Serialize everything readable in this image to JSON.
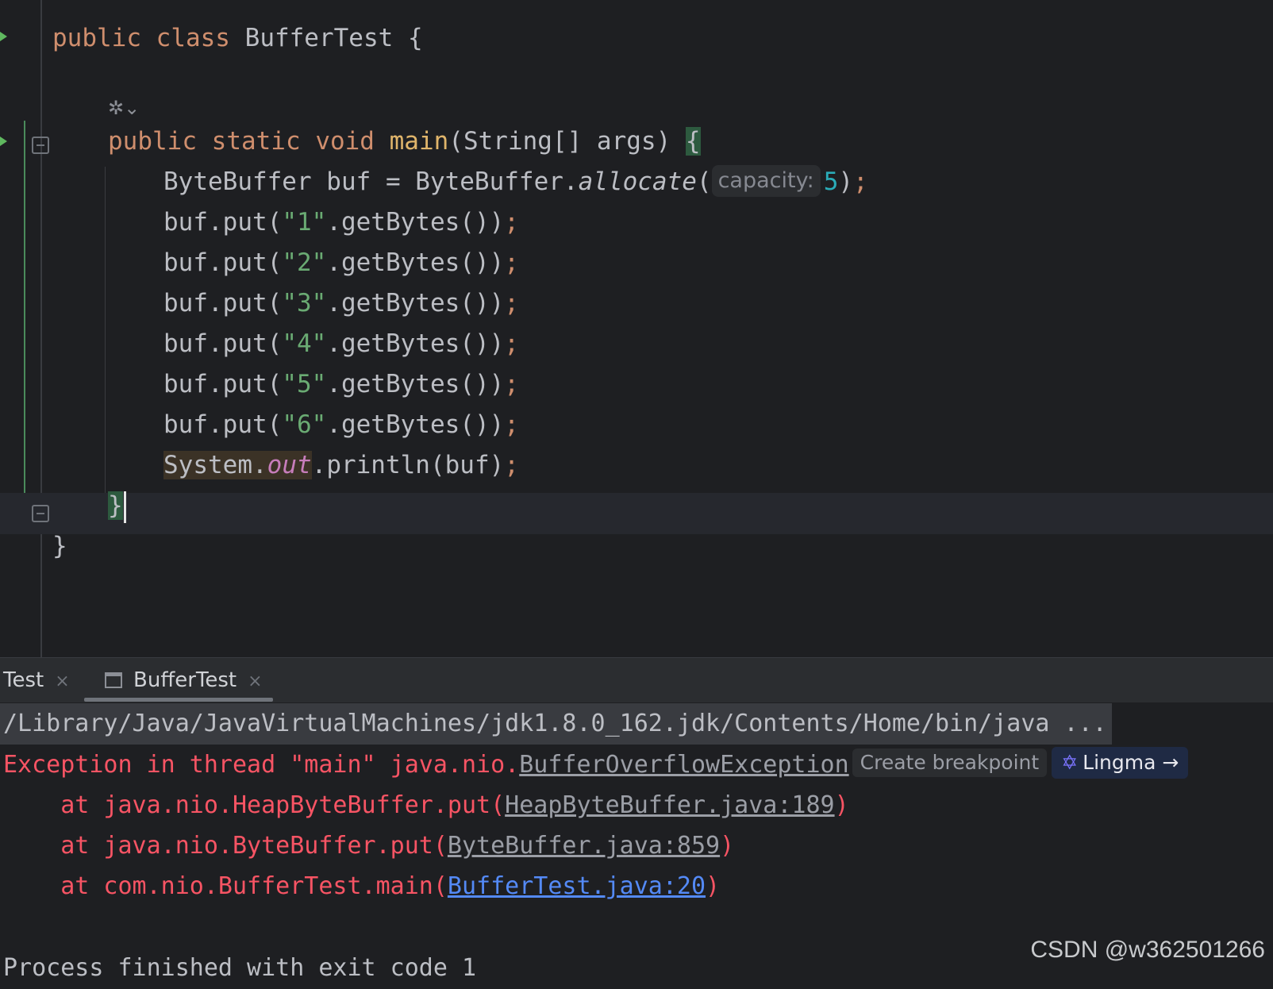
{
  "editor": {
    "class_kw1": "public",
    "class_kw2": "class",
    "class_name": "BufferTest",
    "open_brace": "{",
    "ai_icon": "✲⌄",
    "main_kw1": "public",
    "main_kw2": "static",
    "main_kw3": "void",
    "main_name": "main",
    "main_params": "(String[] args) ",
    "main_brace": "{",
    "alloc_prefix": "ByteBuffer buf = ByteBuffer.",
    "alloc_fn": "allocate",
    "alloc_open": "(",
    "alloc_hint": "capacity:",
    "alloc_num": "5",
    "alloc_close": ")",
    "semi": ";",
    "put_prefix": "buf.put(",
    "put_suffix": ".getBytes())",
    "put_strings": [
      "\"1\"",
      "\"2\"",
      "\"3\"",
      "\"4\"",
      "\"5\"",
      "\"6\""
    ],
    "println_sys": "System.",
    "println_out": "out",
    "println_rest": ".println(buf)",
    "close_main": "}",
    "close_class": "}"
  },
  "panel": {
    "tabs": [
      {
        "label": "Test",
        "close": "×"
      },
      {
        "label": "BufferTest",
        "close": "×"
      }
    ],
    "output": {
      "path": "/Library/Java/JavaVirtualMachines/jdk1.8.0_162.jdk/Contents/Home/bin/java ...",
      "exception_prefix": "Exception in thread \"main\" java.nio.",
      "exception_class": "BufferOverflowException",
      "create_breakpoint": "Create breakpoint",
      "lingma": "Lingma →",
      "lingma_icon": "✡",
      "stack": [
        {
          "prefix": "    at java.nio.HeapByteBuffer.put(",
          "link": "HeapByteBuffer.java:189",
          "suffix": ")"
        },
        {
          "prefix": "    at java.nio.ByteBuffer.put(",
          "link": "ByteBuffer.java:859",
          "suffix": ")"
        },
        {
          "prefix": "    at com.nio.BufferTest.main(",
          "link": "BufferTest.java:20",
          "suffix": ")"
        }
      ],
      "process": "Process finished with exit code 1"
    }
  },
  "watermark": "CSDN @w362501266",
  "colors": {
    "background": "#1e1f22",
    "keyword": "#cf8e6d",
    "string": "#6aab73",
    "number": "#2aacb8",
    "error": "#f75464",
    "link": "#548af7"
  }
}
